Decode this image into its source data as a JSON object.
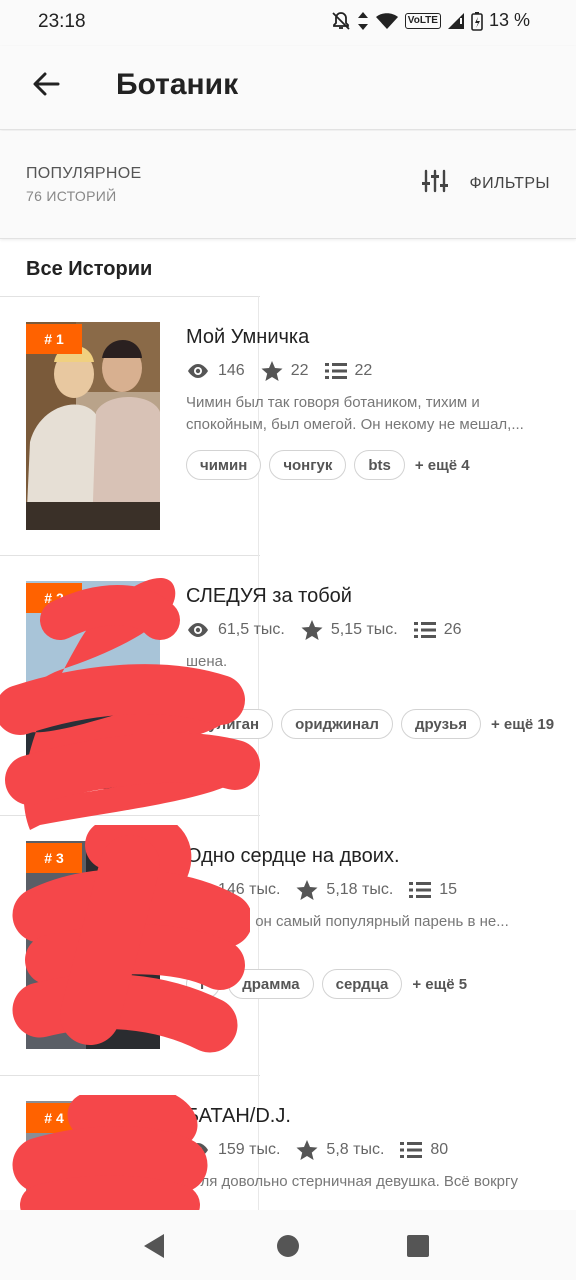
{
  "status_bar": {
    "time": "23:18",
    "network_label": "VoLTE",
    "battery": "13 %"
  },
  "header": {
    "title": "Ботаник"
  },
  "filter_bar": {
    "sort_label": "ПОПУЛЯРНОЕ",
    "count": "76 ИСТОРИЙ",
    "filters_label": "ФИЛЬТРЫ"
  },
  "section_title": "Все Истории",
  "colors": {
    "accent": "#ff6200",
    "redaction": "#f5474a"
  },
  "stories": [
    {
      "rank": "# 1",
      "title": "Мой Умничка",
      "views": "146",
      "votes": "22",
      "parts": "22",
      "description": "Чимин был так говоря ботаником, тихим и спокойным, был омегой. Он некому не мешал,...",
      "tags": [
        "чимин",
        "чонгук",
        "bts"
      ],
      "more": "+ ещё 4"
    },
    {
      "rank": "# 2",
      "title": "СЛЕДУЯ за тобой",
      "views": "61,5 тыс.",
      "votes": "5,15 тыс.",
      "parts": "26",
      "description": "шена.",
      "tags": [
        "хулиган",
        "ориджинал",
        "друзья"
      ],
      "more": "+ ещё 19"
    },
    {
      "rank": "# 3",
      "title": "Одно сердце на двоих.",
      "views": "146 тыс.",
      "votes": "5,18 тыс.",
      "parts": "15",
      "description": "н бабник, он самый популярный парень в не...",
      "tags": [
        "г",
        "драмма",
        "сердца"
      ],
      "more": "+ ещё 5"
    },
    {
      "rank": "# 4",
      "title": "БАТАН/D.J.",
      "views": "159 тыс.",
      "votes": "5,8 тыс.",
      "parts": "80",
      "description": "Юля довольно стерничная девушка. Всё вокргу",
      "tags": [],
      "more": ""
    }
  ]
}
